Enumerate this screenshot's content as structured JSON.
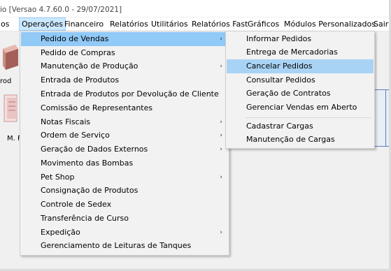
{
  "window": {
    "title": "io [Versao 4.7.60.0 - 29/07/2021]"
  },
  "menubar": {
    "items": [
      "os",
      "Operações",
      "Financeiro",
      "Relatórios",
      "Utilitários",
      "Relatórios Fast",
      "Gráficos",
      "Módulos Personalizados",
      "Sair"
    ]
  },
  "toolbar": {
    "label_1": "rod",
    "label_2": "M. F"
  },
  "operacoes_menu": {
    "items": [
      "Pedido de Vendas",
      "Pedido de Compras",
      "Manutenção de Produção",
      "Entrada de Produtos",
      "Entrada de Produtos por Devolução de Cliente",
      "Comissão de Representantes",
      "Notas Fiscais",
      "Ordem de Serviço",
      "Geração de Dados Externos",
      "Movimento das Bombas",
      "Pet Shop",
      "Consignação de Produtos",
      "Controle de Sedex",
      "Transferência de Curso",
      "Expedição",
      "Gerenciamento de Leituras de Tanques"
    ],
    "submenu_arrow": "›"
  },
  "pedido_vendas_submenu": {
    "items": [
      "Informar Pedidos",
      "Entrega de Mercadorias",
      "Cancelar Pedidos",
      "Consultar Pedidos",
      "Geração de Contratos",
      "Gerenciar Vendas em Aberto",
      "Cadastrar Cargas",
      "Manutenção de Cargas"
    ]
  },
  "colors": {
    "highlight": "#91c9f7",
    "menu_active": "#cce8ff"
  }
}
